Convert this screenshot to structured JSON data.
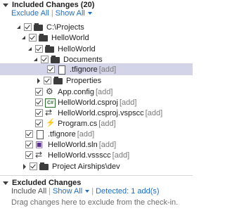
{
  "included": {
    "title": "Included Changes (20)",
    "exclude_all": "Exclude All",
    "show_all": "Show All",
    "tree": [
      {
        "label": "C:\\Projects",
        "tag": "",
        "icon": "folder-icon"
      },
      {
        "label": "HelloWorld",
        "tag": "",
        "icon": "folder-icon"
      },
      {
        "label": "HelloWorld",
        "tag": "",
        "icon": "folder-icon"
      },
      {
        "label": "Documents",
        "tag": "",
        "icon": "folder-icon"
      },
      {
        "label": ".tfignore",
        "tag": "[add]",
        "icon": "file-icon"
      },
      {
        "label": "Properties",
        "tag": "",
        "icon": "folder-icon"
      },
      {
        "label": "App.config",
        "tag": "[add]",
        "icon": "config-icon"
      },
      {
        "label": "HelloWorld.csproj",
        "tag": "[add]",
        "icon": "csproj-icon"
      },
      {
        "label": "HelloWorld.csproj.vspscc",
        "tag": "[add]",
        "icon": "vspscc-icon"
      },
      {
        "label": "Program.cs",
        "tag": "[add]",
        "icon": "csharp-file-icon"
      },
      {
        "label": ".tfignore",
        "tag": "[add]",
        "icon": "file-icon"
      },
      {
        "label": "HelloWorld.sln",
        "tag": "[add]",
        "icon": "solution-icon"
      },
      {
        "label": "HelloWorld.vssscc",
        "tag": "[add]",
        "icon": "vssscc-icon"
      },
      {
        "label": "Project Airships\\dev",
        "tag": "",
        "icon": "folder-icon"
      }
    ]
  },
  "excluded": {
    "title": "Excluded Changes",
    "include_all": "Include All",
    "show_all": "Show All",
    "detected": "Detected: 1 add(s)",
    "hint": "Drag changes here to exclude from the check-in."
  }
}
